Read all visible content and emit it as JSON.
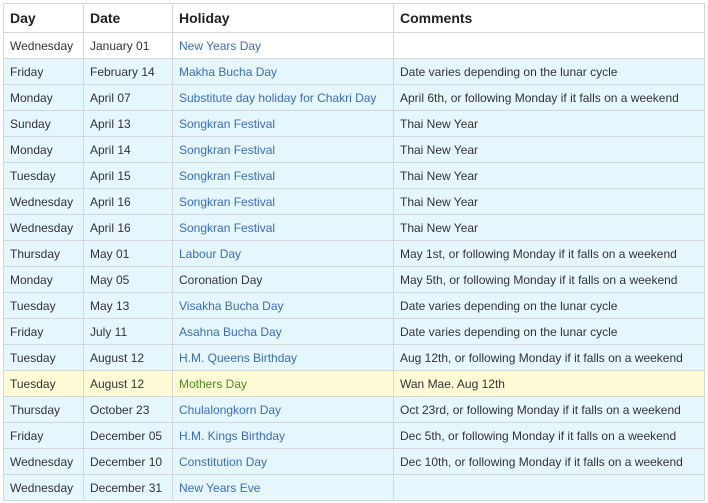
{
  "table": {
    "headers": {
      "day": "Day",
      "date": "Date",
      "holiday": "Holiday",
      "comments": "Comments"
    },
    "rows": [
      {
        "style": "white",
        "link": "link",
        "day": "Wednesday",
        "date": "January 01",
        "holiday": "New Years Day",
        "comments": ""
      },
      {
        "style": "blue",
        "link": "link",
        "day": "Friday",
        "date": "February 14",
        "holiday": "Makha Bucha Day",
        "comments": "Date varies depending on the lunar cycle"
      },
      {
        "style": "blue",
        "link": "link",
        "day": "Monday",
        "date": "April 07",
        "holiday": "Substitute day holiday for Chakri Day",
        "comments": "April 6th, or following Monday if it falls on a weekend"
      },
      {
        "style": "blue",
        "link": "link",
        "day": "Sunday",
        "date": "April 13",
        "holiday": "Songkran Festival",
        "comments": "Thai New Year"
      },
      {
        "style": "blue",
        "link": "link",
        "day": "Monday",
        "date": "April 14",
        "holiday": "Songkran Festival",
        "comments": "Thai New Year"
      },
      {
        "style": "blue",
        "link": "link",
        "day": "Tuesday",
        "date": "April 15",
        "holiday": "Songkran Festival",
        "comments": "Thai New Year"
      },
      {
        "style": "blue",
        "link": "link",
        "day": "Wednesday",
        "date": "April 16",
        "holiday": "Songkran Festival",
        "comments": "Thai New Year"
      },
      {
        "style": "blue",
        "link": "link",
        "day": "Wednesday",
        "date": "April 16",
        "holiday": "Songkran Festival",
        "comments": "Thai New Year"
      },
      {
        "style": "blue",
        "link": "link",
        "day": "Thursday",
        "date": "May 01",
        "holiday": "Labour Day",
        "comments": "May 1st, or following Monday if it falls on a weekend"
      },
      {
        "style": "blue",
        "link": "plain",
        "day": "Monday",
        "date": "May 05",
        "holiday": "Coronation Day",
        "comments": "May 5th, or following Monday if it falls on a weekend"
      },
      {
        "style": "blue",
        "link": "link",
        "day": "Tuesday",
        "date": "May 13",
        "holiday": "Visakha Bucha Day",
        "comments": "Date varies depending on the lunar cycle"
      },
      {
        "style": "blue",
        "link": "link",
        "day": "Friday",
        "date": "July 11",
        "holiday": "Asahna Bucha Day",
        "comments": "Date varies depending on the lunar cycle"
      },
      {
        "style": "blue",
        "link": "link",
        "day": "Tuesday",
        "date": "August 12",
        "holiday": "H.M. Queens Birthday",
        "comments": "Aug 12th, or following Monday if it falls on a weekend"
      },
      {
        "style": "yellow",
        "link": "green",
        "day": "Tuesday",
        "date": "August 12",
        "holiday": "Mothers Day",
        "comments": "Wan Mae. Aug 12th"
      },
      {
        "style": "blue",
        "link": "link",
        "day": "Thursday",
        "date": "October 23",
        "holiday": "Chulalongkorn Day",
        "comments": "Oct 23rd, or following Monday if it falls on a weekend"
      },
      {
        "style": "blue",
        "link": "link",
        "day": "Friday",
        "date": "December 05",
        "holiday": "H.M. Kings Birthday",
        "comments": "Dec 5th, or following Monday if it falls on a weekend"
      },
      {
        "style": "blue",
        "link": "link",
        "day": "Wednesday",
        "date": "December 10",
        "holiday": "Constitution Day",
        "comments": "Dec 10th, or following Monday if it falls on a weekend"
      },
      {
        "style": "blue",
        "link": "link",
        "day": "Wednesday",
        "date": "December 31",
        "holiday": "New Years Eve",
        "comments": ""
      }
    ]
  },
  "colors": {
    "link": "#3a6fb5",
    "row_blue": "#e6f6fd",
    "row_yellow": "#fdfbd6",
    "mothers_day_text": "#4e8a1e",
    "border": "#d6d6d6"
  }
}
